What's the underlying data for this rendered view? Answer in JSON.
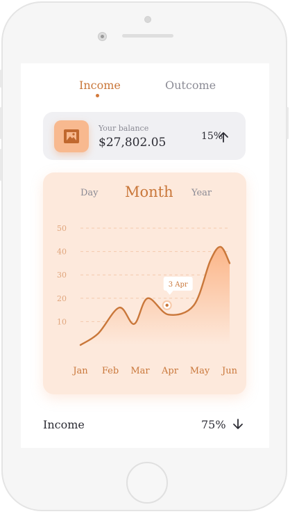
{
  "tabs": {
    "income": "Income",
    "outcome": "Outcome",
    "active": "income"
  },
  "balance": {
    "label": "Your balance",
    "value": "$27,802.05",
    "change": "15%",
    "icon": "wallet-image-icon",
    "trend_icon": "arrow-up-icon"
  },
  "periods": {
    "day": "Day",
    "month": "Month",
    "year": "Year",
    "active": "month"
  },
  "chart_data": {
    "type": "area",
    "categories": [
      "Jan",
      "Feb",
      "Mar",
      "Apr",
      "May",
      "Jun"
    ],
    "x": [
      0,
      0.6,
      1.3,
      1.8,
      2.25,
      2.95,
      3.8,
      4.35,
      4.7,
      5.0
    ],
    "y": [
      0,
      5,
      16,
      9,
      20,
      13,
      17,
      36,
      42,
      35
    ],
    "yticks": [
      10,
      20,
      30,
      40,
      50
    ],
    "ylim": [
      0,
      50
    ],
    "annotation": {
      "label": "3 Apr",
      "x": 2.9,
      "y": 17
    },
    "colors": {
      "line": "#c9773a",
      "fill_top": "#fbb588",
      "fill_bottom": "#fde9dc"
    },
    "grid": true
  },
  "footer": {
    "label": "Income",
    "value": "75%",
    "trend_icon": "arrow-down-icon"
  }
}
